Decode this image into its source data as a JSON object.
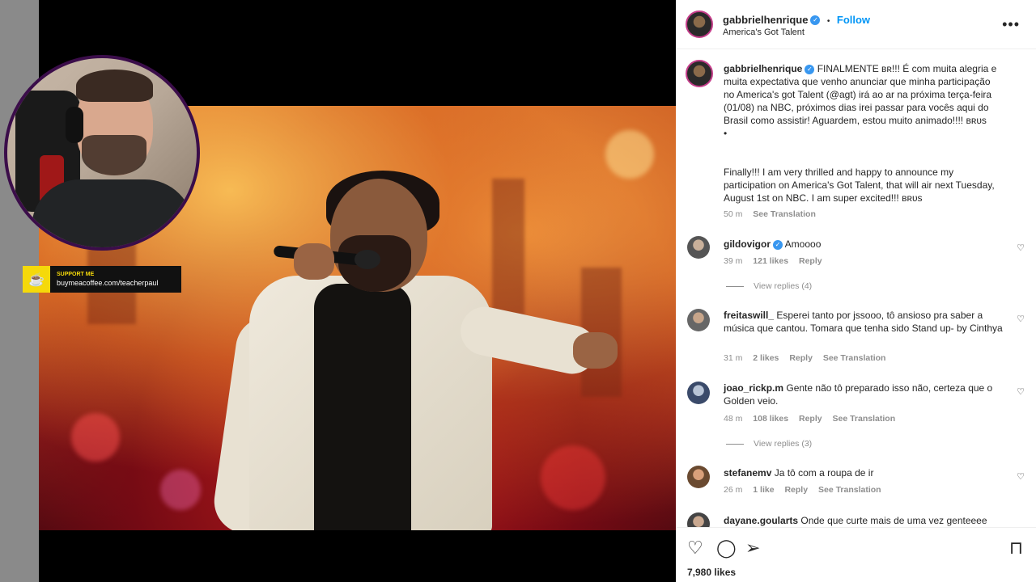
{
  "post": {
    "author": "gabbrielhenrique",
    "dot": "•",
    "follow_label": "Follow",
    "location": "America's Got Talent",
    "more": "•••"
  },
  "caption": {
    "username": "gabbrielhenrique",
    "text_pt": "FINALMENTE ʙʀ!!! É com muita alegria e muita expectativa que venho anunciar que minha participação no America's got Talent (@agt) irá ao ar na próxima terça-feira (01/08) na NBC, próximos dias irei passar para vocês aqui do Brasil como assistir! Aguardem, estou muito animado!!!! ʙʀᴜs",
    "dot": "•",
    "text_en": "Finally!!! I am very thrilled and happy to announce my participation on America's Got Talent, that will air next Tuesday, August 1st on NBC. I am super excited!!! ʙʀᴜs",
    "time": "50 m",
    "see_translation": "See Translation"
  },
  "comments": [
    {
      "username": "gildovigor",
      "verified": true,
      "text": "Amoooo",
      "time": "39 m",
      "likes": "121 likes",
      "reply": "Reply",
      "translation": "",
      "view_replies": "View replies (4)"
    },
    {
      "username": "freitaswill_",
      "verified": false,
      "text": "Esperei tanto por jssooo, tô ansioso pra saber a música que cantou. Tomara que tenha sido Stand up- by Cinthya",
      "time": "31 m",
      "likes": "2 likes",
      "reply": "Reply",
      "translation": "See Translation",
      "view_replies": ""
    },
    {
      "username": "joao_rickp.m",
      "verified": false,
      "text": "Gente não tô preparado isso não, certeza que o Golden veio.",
      "time": "48 m",
      "likes": "108 likes",
      "reply": "Reply",
      "translation": "See Translation",
      "view_replies": "View replies (3)"
    },
    {
      "username": "stefanemv",
      "verified": false,
      "text": "Ja tô com a roupa de ir",
      "time": "26 m",
      "likes": "1 like",
      "reply": "Reply",
      "translation": "See Translation",
      "view_replies": ""
    },
    {
      "username": "dayane.goularts",
      "verified": false,
      "text": "Onde que curte mais de uma vez genteeee",
      "time": "",
      "likes": "",
      "reply": "",
      "translation": "",
      "view_replies": ""
    }
  ],
  "actions": {
    "like_icon": "heart-icon",
    "comment_icon": "comment-icon",
    "share_icon": "send-icon",
    "save_icon": "bookmark-icon",
    "likes_count": "7,980 likes"
  },
  "overlay": {
    "support_title": "SUPPORT ME",
    "support_url": "buymeacoffee.com/teacherpaul"
  },
  "colors": {
    "accent": "#0095f6",
    "verified": "#3897f0",
    "support_yellow": "#f5d90a",
    "webcam_ring": "#3b0d4a"
  }
}
